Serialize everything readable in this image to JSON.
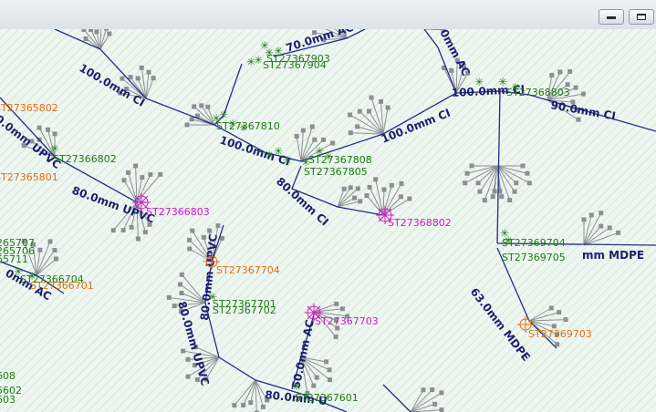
{
  "window": {
    "minimize_icon": "minimize-icon",
    "maximize_icon": "maximize-icon"
  },
  "colors": {
    "pipe": "#1f2f86",
    "green_label": "#1d7a12",
    "magenta_label": "#d218c4",
    "orange_label": "#e46e12",
    "service_line": "#8a8f94"
  },
  "pipes": {
    "p1": "100.0mm CI",
    "p2": "0.0mm UPVC",
    "p3": "80.0mm UPVC",
    "p4": "70.0mm AC",
    "p5": "0mm AC",
    "p6": "100.0mm CI",
    "p7": "100.0mm CI",
    "p8": "90.0mm CI",
    "p9": "100.0mm CI",
    "p10": "80.0mm CI",
    "p11": "mm MDPE",
    "p12": "63.0mm MDPE",
    "p13": "80.0mm UPVC",
    "p14": "80.0mm UPVC",
    "p15": "50.0mm AC",
    "p16": "80.0mm U",
    "p17": "0mm AC"
  },
  "assets": {
    "a1": "ST27365802",
    "a2": "ST27366802",
    "a3": "ST27365801",
    "a4": "ST27366803",
    "a5": "ST27367704",
    "a6": "ST27367701",
    "a7": "ST27367702",
    "a8": "ST27367703",
    "a9": "ST27368802",
    "a10": "ST27369704",
    "a11": "ST27369703",
    "a12": "ST27367601",
    "a13": "ST27368803",
    "a14": "ST27367805",
    "a15": "ST27366701",
    "a16": "ST27367810",
    "a17": "ST27367808",
    "a18": "ST27367903",
    "a19": "ST27369705",
    "a20": "ST27367904",
    "a21": "ST27366704",
    "a22": "265707",
    "a23": "265706",
    "a24": "65711",
    "a25": "608",
    "a26": "5602",
    "a27": "603"
  }
}
